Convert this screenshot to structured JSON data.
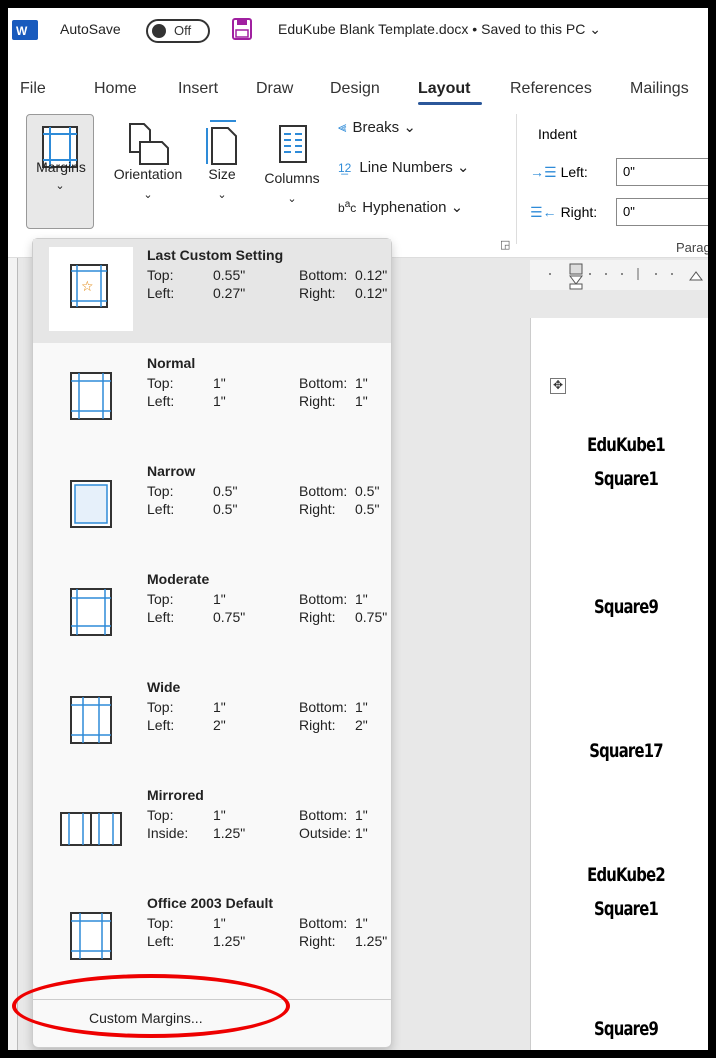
{
  "titlebar": {
    "autosave_label": "AutoSave",
    "toggle_state": "Off",
    "doc_title": "EduKube Blank Template.docx • Saved to this PC ⌄"
  },
  "tabs": [
    "File",
    "Home",
    "Insert",
    "Draw",
    "Design",
    "Layout",
    "References",
    "Mailings"
  ],
  "active_tab": "Layout",
  "ribbon": {
    "margins": "Margins",
    "orientation": "Orientation",
    "size": "Size",
    "columns": "Columns",
    "breaks": "Breaks ⌄",
    "line_numbers": "Line Numbers ⌄",
    "hyphenation": "Hyphenation ⌄",
    "indent_title": "Indent",
    "left_label": "Left:",
    "left_value": "0\"",
    "right_label": "Right:",
    "right_value": "0\"",
    "paragraph_group": "Parag"
  },
  "margin_options": [
    {
      "name": "Last Custom Setting",
      "r1": [
        "Top:",
        "0.55\"",
        "Bottom:",
        "0.12\""
      ],
      "r2": [
        "Left:",
        "0.27\"",
        "Right:",
        "0.12\""
      ],
      "selected": true
    },
    {
      "name": "Normal",
      "r1": [
        "Top:",
        "1\"",
        "Bottom:",
        "1\""
      ],
      "r2": [
        "Left:",
        "1\"",
        "Right:",
        "1\""
      ]
    },
    {
      "name": "Narrow",
      "r1": [
        "Top:",
        "0.5\"",
        "Bottom:",
        "0.5\""
      ],
      "r2": [
        "Left:",
        "0.5\"",
        "Right:",
        "0.5\""
      ]
    },
    {
      "name": "Moderate",
      "r1": [
        "Top:",
        "1\"",
        "Bottom:",
        "1\""
      ],
      "r2": [
        "Left:",
        "0.75\"",
        "Right:",
        "0.75\""
      ]
    },
    {
      "name": "Wide",
      "r1": [
        "Top:",
        "1\"",
        "Bottom:",
        "1\""
      ],
      "r2": [
        "Left:",
        "2\"",
        "Right:",
        "2\""
      ]
    },
    {
      "name": "Mirrored",
      "r1": [
        "Top:",
        "1\"",
        "Bottom:",
        "1\""
      ],
      "r2": [
        "Inside:",
        "1.25\"",
        "Outside:",
        "1\""
      ]
    },
    {
      "name": "Office 2003 Default",
      "r1": [
        "Top:",
        "1\"",
        "Bottom:",
        "1\""
      ],
      "r2": [
        "Left:",
        "1.25\"",
        "Right:",
        "1.25\""
      ]
    }
  ],
  "custom_margins": "Custom Margins...",
  "document_lines": [
    "EduKube1",
    "Square1",
    "Square9",
    "Square17",
    "EduKube2",
    "Square1",
    "Square9"
  ],
  "colors": {
    "accent": "#2b579a",
    "highlight": "#e00000",
    "margin_blue": "#2e8bd8"
  }
}
